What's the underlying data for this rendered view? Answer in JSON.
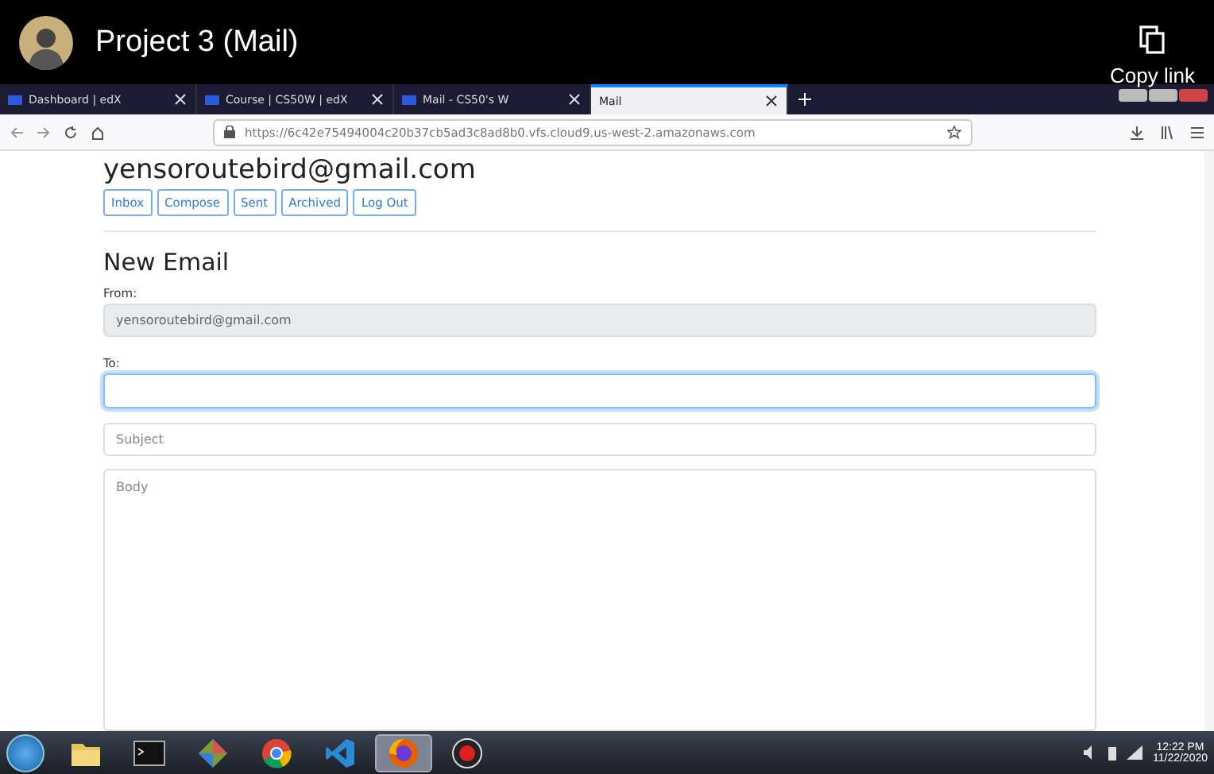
{
  "video": {
    "title": "Project 3 (Mail)",
    "copy_link": "Copy link"
  },
  "browser": {
    "tabs": [
      {
        "label": "Dashboard | edX",
        "selected": false
      },
      {
        "label": "Course | CS50W | edX",
        "selected": false
      },
      {
        "label": "Mail - CS50's W",
        "selected": false
      },
      {
        "label": "Mail",
        "selected": true
      }
    ],
    "url": "https://6c42e75494004c20b37cb5ad3c8ad8b0.vfs.cloud9.us-west-2.amazonaws.com"
  },
  "page": {
    "user": "yensoroutebird@gmail.com",
    "nav": [
      "Inbox",
      "Compose",
      "Sent",
      "Archived",
      "Log Out"
    ],
    "heading": "New Email",
    "from_label": "From:",
    "from_value": "yensoroutebird@gmail.com",
    "to_label": "To:",
    "to": {
      "focused": true
    },
    "subject": {
      "placeholder": "Subject"
    },
    "body": {
      "placeholder": "Body"
    }
  },
  "taskbar": {
    "apps": [
      {
        "kind": "folder",
        "selected": false
      },
      {
        "kind": "terminal",
        "selected": false
      },
      {
        "kind": "git",
        "selected": false
      },
      {
        "kind": "chrome",
        "selected": false
      },
      {
        "kind": "vscode",
        "selected": false
      },
      {
        "kind": "firefox",
        "selected": true
      },
      {
        "kind": "recorder",
        "selected": false
      }
    ],
    "time": "12:22 PM",
    "date": "11/22/2020"
  }
}
